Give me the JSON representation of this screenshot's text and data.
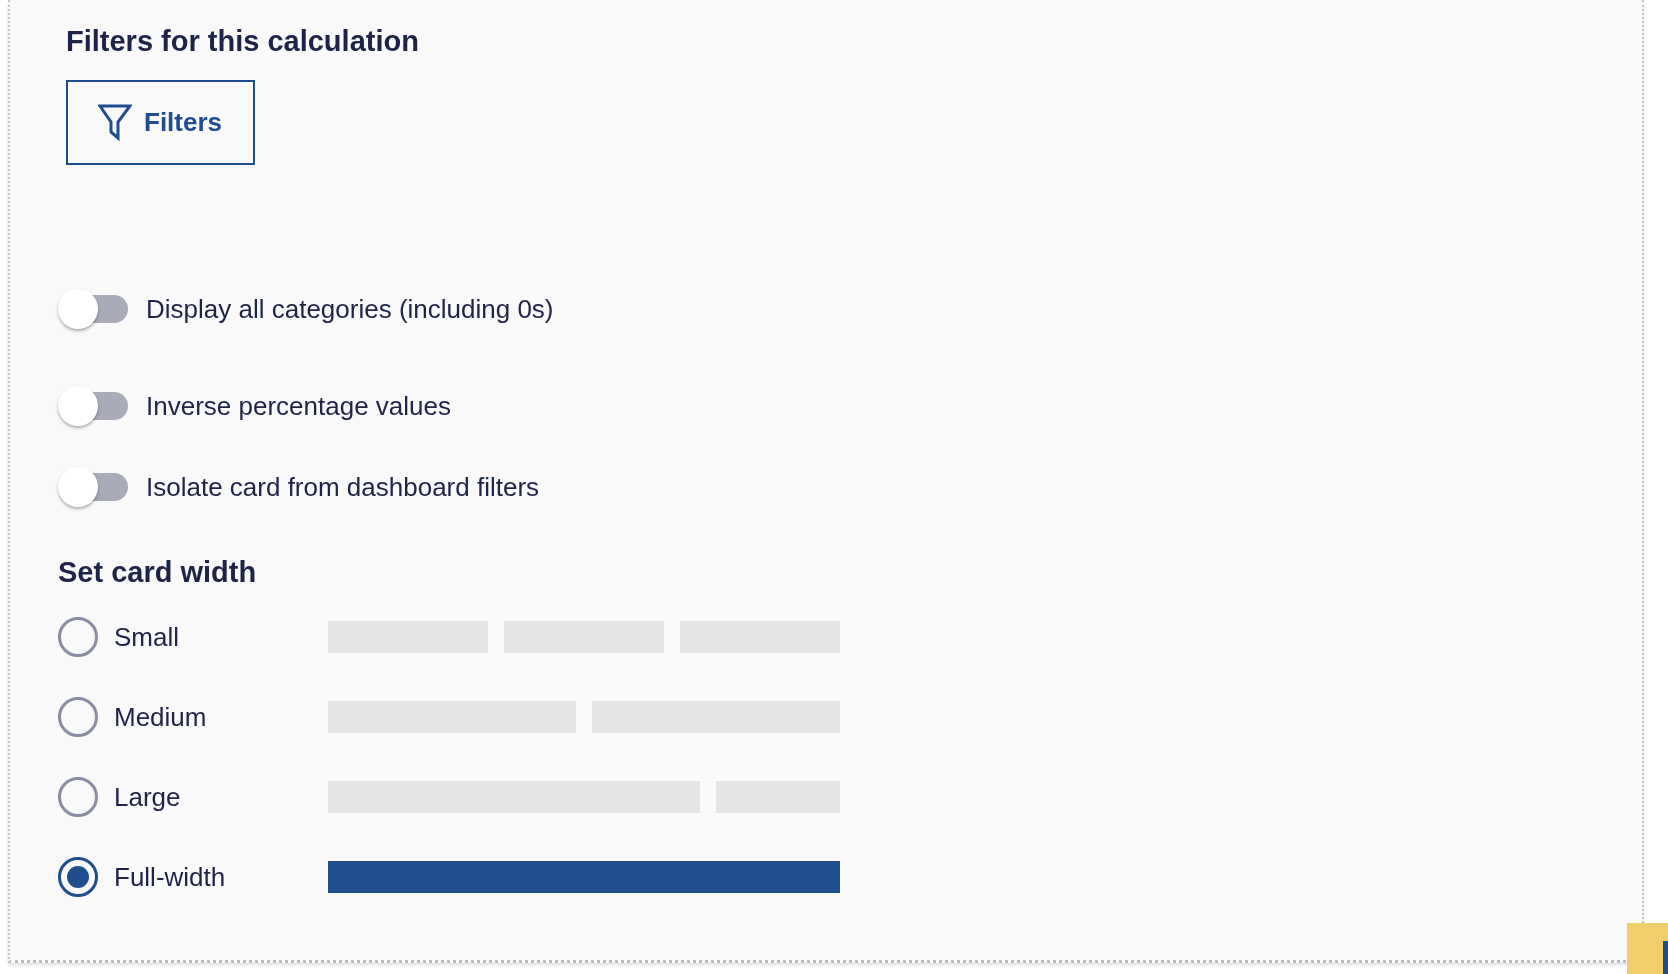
{
  "filters_section": {
    "title": "Filters for this calculation",
    "button": "Filters"
  },
  "toggles": [
    {
      "label": "Display all categories (including 0s)",
      "on": false
    },
    {
      "label": "Inverse percentage values",
      "on": false
    },
    {
      "label": "Isolate card from dashboard filters",
      "on": false
    }
  ],
  "card_width": {
    "title": "Set card width",
    "options": [
      {
        "label": "Small",
        "kind": "small",
        "selected": false
      },
      {
        "label": "Medium",
        "kind": "medium",
        "selected": false
      },
      {
        "label": "Large",
        "kind": "large",
        "selected": false
      },
      {
        "label": "Full-width",
        "kind": "full",
        "selected": true
      }
    ]
  }
}
